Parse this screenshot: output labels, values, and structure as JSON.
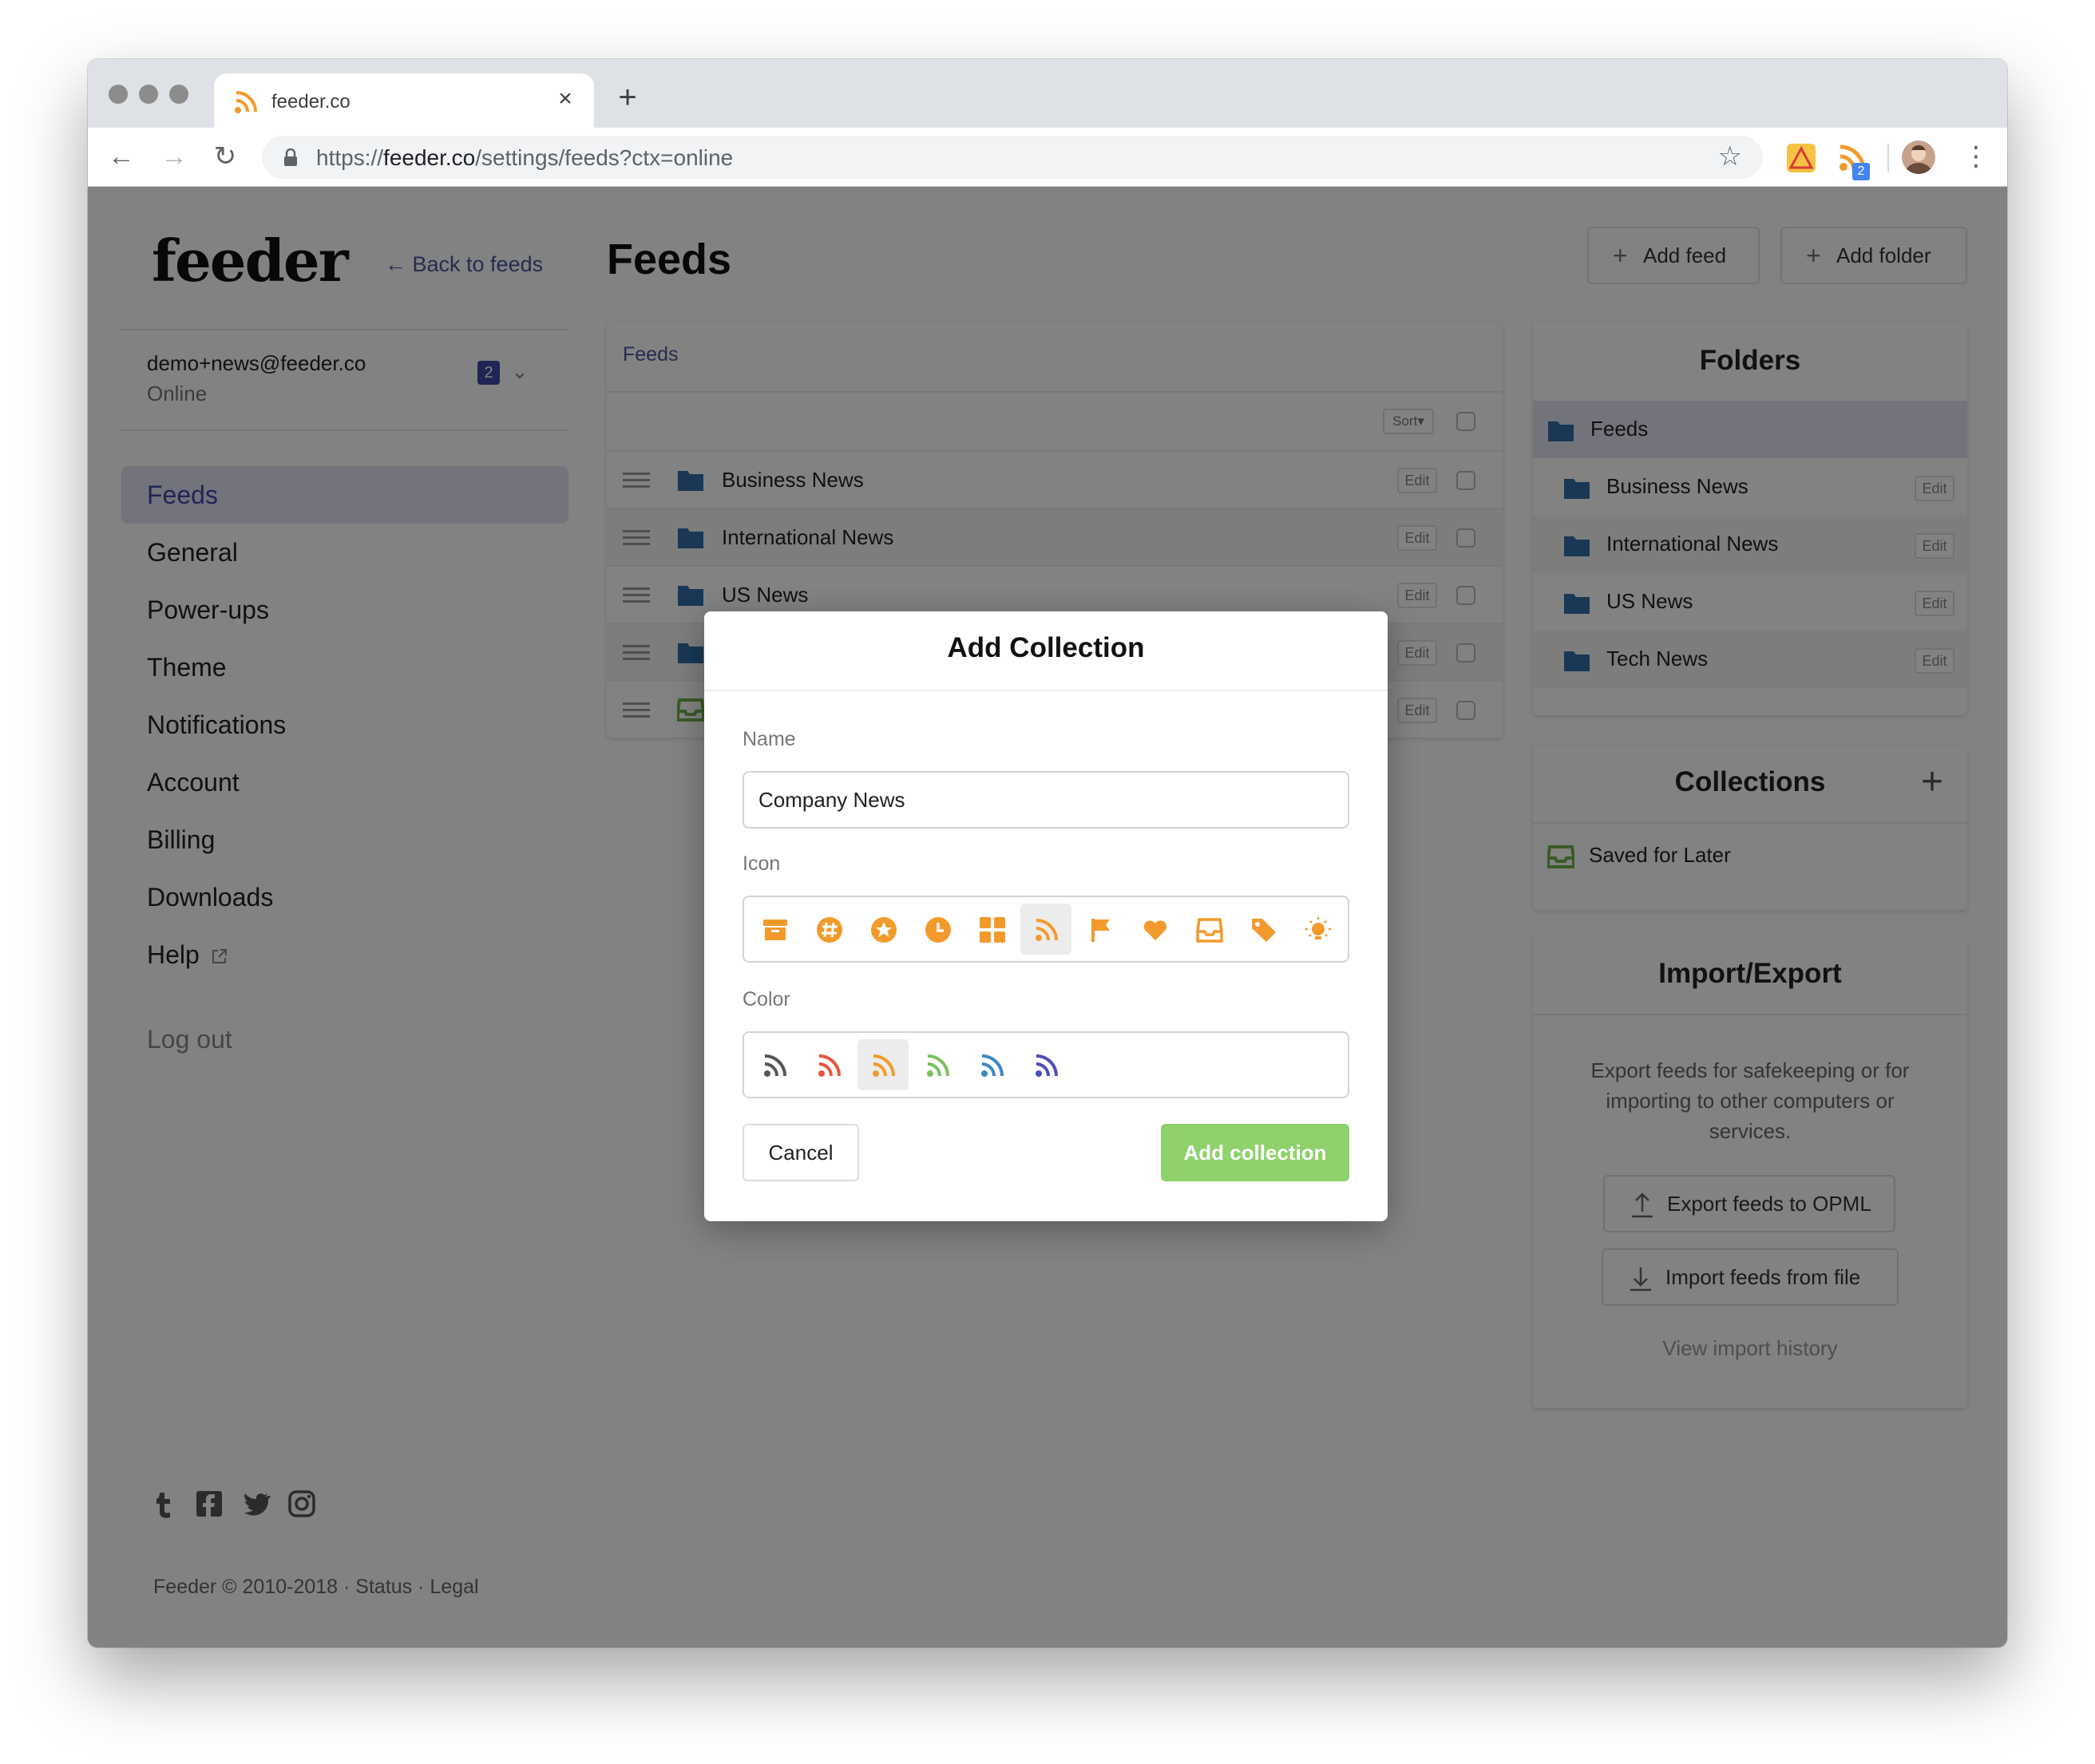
{
  "browser": {
    "tab_title": "feeder.co",
    "url_prefix": "https://",
    "url_host": "feeder.co",
    "url_path": "/settings/feeds?ctx=online",
    "extension_badge": "2"
  },
  "sidebar": {
    "logo": "feeder",
    "back_link": "← Back to feeds",
    "account_email": "demo+news@feeder.co",
    "account_status": "Online",
    "account_badge": "2",
    "nav": [
      {
        "label": "Feeds"
      },
      {
        "label": "General"
      },
      {
        "label": "Power-ups"
      },
      {
        "label": "Theme"
      },
      {
        "label": "Notifications"
      },
      {
        "label": "Account"
      },
      {
        "label": "Billing"
      },
      {
        "label": "Downloads"
      },
      {
        "label": "Help"
      }
    ],
    "logout": "Log out",
    "footer": "Feeder © 2010-2018 · Status · Legal",
    "social": [
      "tumblr-icon",
      "facebook-icon",
      "twitter-icon",
      "instagram-icon"
    ]
  },
  "header": {
    "title": "Feeds",
    "add_feed": "Add feed",
    "add_folder": "Add folder"
  },
  "feeds_list": {
    "breadcrumb": "Feeds",
    "sort_label": "Sort▾",
    "edit_label": "Edit",
    "rows": [
      {
        "name": "Business News",
        "icon": "folder-icon"
      },
      {
        "name": "International News",
        "icon": "folder-icon"
      },
      {
        "name": "US News",
        "icon": "folder-icon"
      },
      {
        "name": "",
        "icon": "folder-icon"
      },
      {
        "name": "",
        "icon": "inbox-icon"
      }
    ]
  },
  "folders": {
    "title": "Folders",
    "root": "Feeds",
    "edit_label": "Edit",
    "items": [
      {
        "name": "Business News"
      },
      {
        "name": "International News"
      },
      {
        "name": "US News"
      },
      {
        "name": "Tech News"
      }
    ]
  },
  "collections": {
    "title": "Collections",
    "items": [
      {
        "name": "Saved for Later",
        "color": "#6fb24b"
      }
    ]
  },
  "import_export": {
    "title": "Import/Export",
    "description": "Export feeds for safekeeping or for importing to other computers or services.",
    "export_button": "Export feeds to OPML",
    "import_button": "Import feeds from file",
    "history_link": "View import history"
  },
  "modal": {
    "title": "Add Collection",
    "name_label": "Name",
    "name_value": "Company News",
    "icon_label": "Icon",
    "icons": [
      "archive-icon",
      "hashtag-icon",
      "star-icon",
      "clock-icon",
      "grid-icon",
      "rss-icon",
      "flag-icon",
      "heart-icon",
      "inbox-icon",
      "tag-icon",
      "lightbulb-icon"
    ],
    "selected_icon": "rss-icon",
    "color_label": "Color",
    "colors": [
      "#555555",
      "#e8553f",
      "#f39a2c",
      "#7cc25a",
      "#3c87c8",
      "#4a4fb5"
    ],
    "selected_color": "#f39a2c",
    "cancel": "Cancel",
    "submit": "Add collection"
  },
  "colors": {
    "accent": "#3f4aa6",
    "folder_blue": "#2f6fa8",
    "primary_button": "#8dd26a",
    "icon_orange": "#f39a2c"
  }
}
